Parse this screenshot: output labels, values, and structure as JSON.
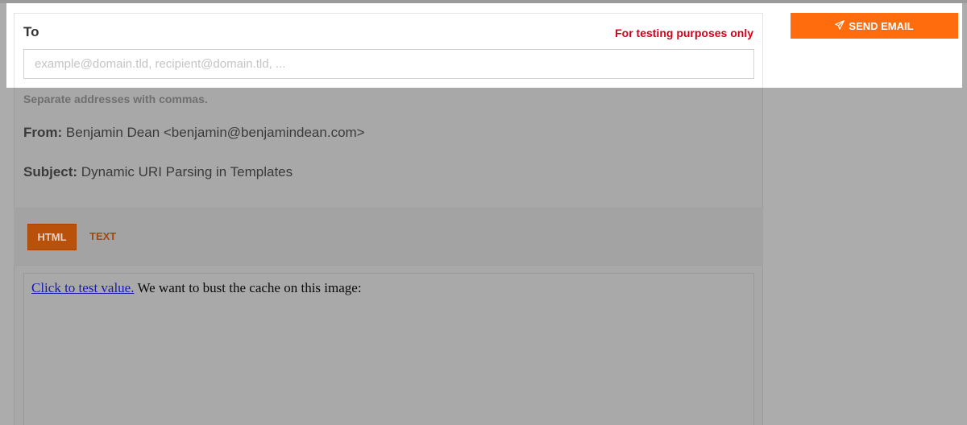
{
  "compose": {
    "to_label": "To",
    "testing_note": "For testing purposes only",
    "to_placeholder": "example@domain.tld, recipient@domain.tld, ...",
    "to_value": "",
    "hint": "Separate addresses with commas.",
    "from_label": "From:",
    "from_value": "Benjamin Dean <benjamin@benjamindean.com>",
    "subject_label": "Subject:",
    "subject_value": "Dynamic URI Parsing in Templates"
  },
  "actions": {
    "send_label": "SEND EMAIL",
    "send_icon": "paper-plane-icon"
  },
  "tabs": [
    {
      "label": "HTML",
      "active": true
    },
    {
      "label": "TEXT",
      "active": false
    }
  ],
  "preview": {
    "link_text": "Click to test value.",
    "body_text": "We want to bust the cache on this image:"
  },
  "colors": {
    "accent": "#ff6c0d",
    "warning": "#d0021b",
    "overlay": "#acacac"
  }
}
